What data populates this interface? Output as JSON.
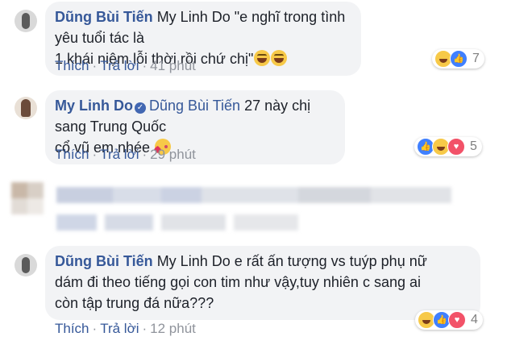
{
  "comments": [
    {
      "author": "Dũng Bùi Tiến",
      "line1": "My Linh Do \"e nghĩ trong tình yêu tuổi tác là",
      "line2": "1 khái niệm lỗi thời rồi chứ chị\"",
      "like_label": "Thích",
      "reply_label": "Trả lời",
      "time": "41 phút",
      "reactions": [
        "haha",
        "like"
      ],
      "reaction_count": "7"
    },
    {
      "author": "My Linh Do",
      "mention": "Dũng Bùi Tiến",
      "line1": "27 này chị sang Trung Quốc",
      "line2": "cổ vũ em nhée",
      "like_label": "Thích",
      "reply_label": "Trả lời",
      "time": "29 phút",
      "reactions": [
        "like",
        "haha",
        "love"
      ],
      "reaction_count": "5"
    },
    {
      "author": "Dũng Bùi Tiến",
      "line1": "My Linh Do e rất ấn tượng vs tuýp phụ nữ",
      "line2": "dám đi theo tiếng gọi con tim như vậy,tuy nhiên c sang ai",
      "line3": "còn tập trung đá nữa???",
      "like_label": "Thích",
      "reply_label": "Trả lời",
      "time": "12 phút",
      "reactions": [
        "haha",
        "like",
        "love"
      ],
      "reaction_count": "4"
    }
  ],
  "icons": {
    "avatar": "avatar-icon",
    "verified": "verified-badge-icon",
    "emoji_laugh": "grinning-emoji-icon",
    "emoji_kiss": "kiss-emoji-icon",
    "reaction_haha": "haha-reaction-icon",
    "reaction_like": "like-reaction-icon",
    "reaction_love": "love-reaction-icon"
  },
  "colors": {
    "link": "#365899",
    "bubble": "#f2f3f5",
    "text": "#1d2129",
    "meta": "#90949c"
  }
}
